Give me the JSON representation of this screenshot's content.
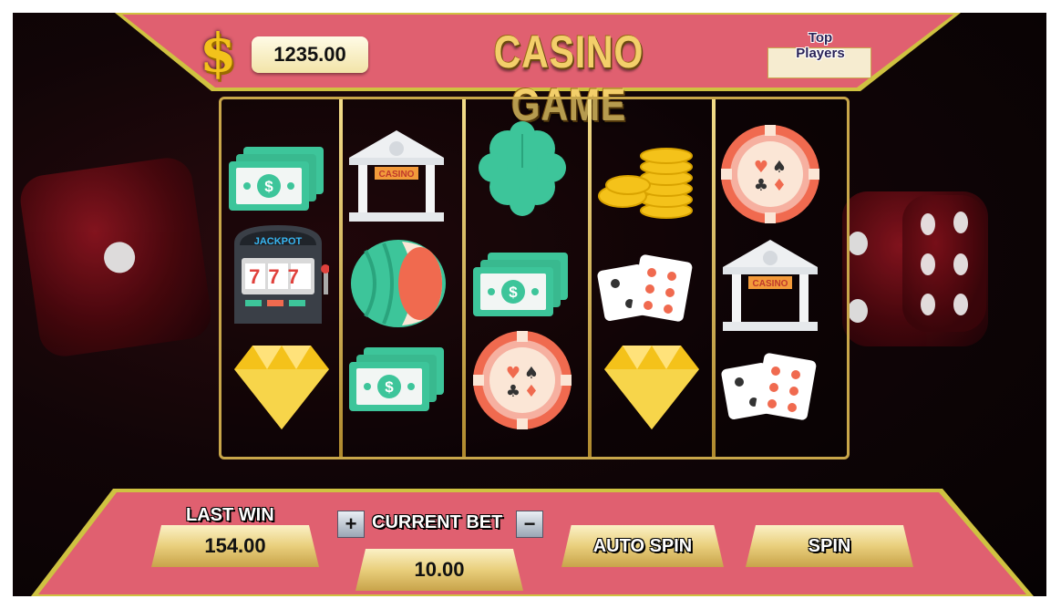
{
  "header": {
    "currency_symbol": "$",
    "balance": "1235.00",
    "title": "CASINO GAME",
    "top_players_label": "Top Players"
  },
  "reels": [
    [
      "cash-stack-icon",
      "slot-machine-icon",
      "diamond-icon"
    ],
    [
      "casino-building-icon",
      "watermelon-icon",
      "cash-stack-icon"
    ],
    [
      "clover-icon",
      "cash-stack-icon",
      "poker-chip-icon"
    ],
    [
      "coin-stack-icon",
      "dice-icon",
      "diamond-icon"
    ],
    [
      "poker-chip-icon",
      "casino-building-icon",
      "dice-icon"
    ]
  ],
  "symbol_text": {
    "casino_sign": "CASINO",
    "jackpot": "JACKPOT",
    "sevens": "777"
  },
  "controls": {
    "last_win_label": "LAST WIN",
    "last_win_value": "154.00",
    "current_bet_label": "CURRENT BET",
    "current_bet_value": "10.00",
    "plus_label": "+",
    "minus_label": "−",
    "auto_spin_label": "AUTO SPIN",
    "spin_label": "SPIN"
  },
  "colors": {
    "header_pink": "#e06070",
    "gold": "#e9cf7c",
    "mint": "#3dc59a",
    "chip_red": "#f06a4f"
  }
}
